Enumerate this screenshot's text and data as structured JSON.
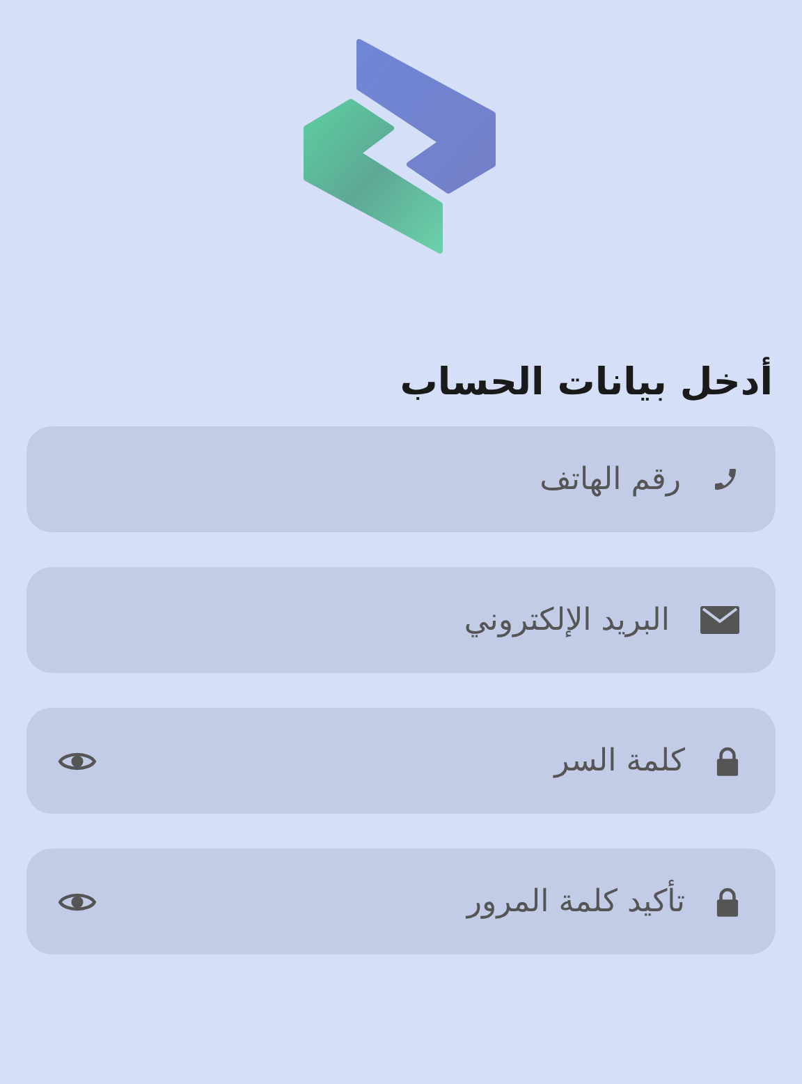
{
  "heading": "أدخل بيانات الحساب",
  "fields": [
    {
      "kind": "phone",
      "placeholder": "رقم الهاتف"
    },
    {
      "kind": "email",
      "placeholder": "البريد الإلكتروني"
    },
    {
      "kind": "password",
      "placeholder": "كلمة السر"
    },
    {
      "kind": "password",
      "placeholder": "تأكيد كلمة المرور"
    }
  ]
}
